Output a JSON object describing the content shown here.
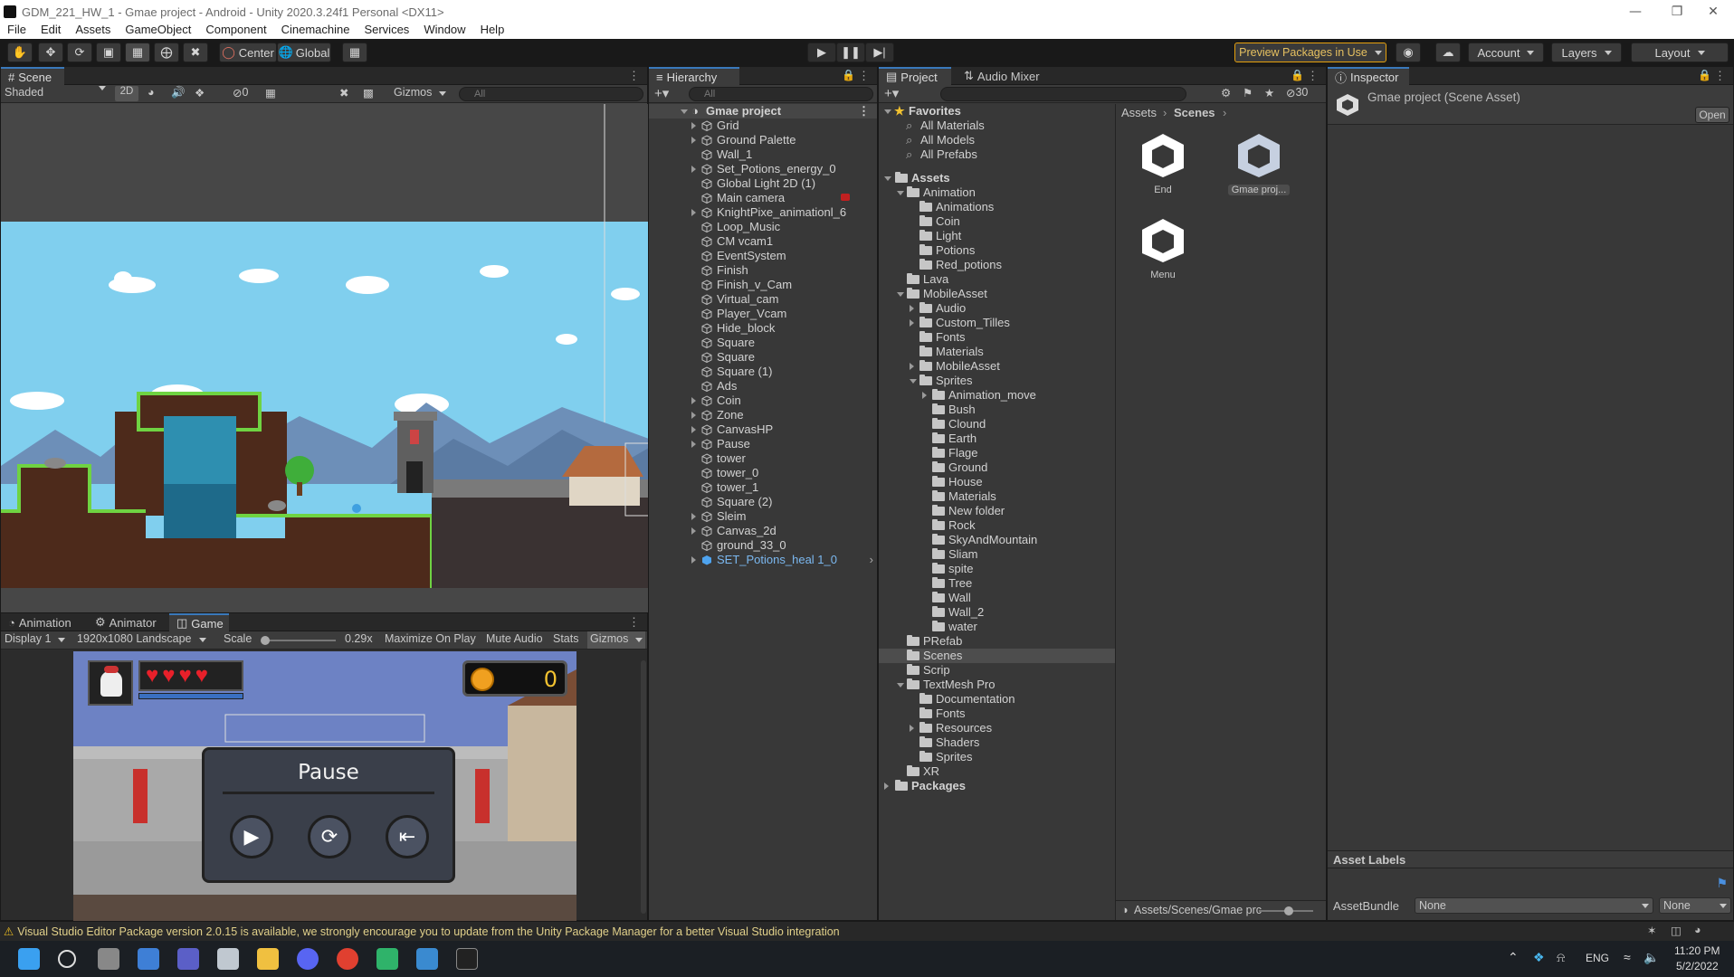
{
  "window": {
    "title": "GDM_221_HW_1 - Gmae project - Android - Unity 2020.3.24f1 Personal <DX11>"
  },
  "menu": [
    "File",
    "Edit",
    "Assets",
    "GameObject",
    "Component",
    "Cinemachine",
    "Services",
    "Window",
    "Help"
  ],
  "toolbar": {
    "pivot_label": "Center",
    "space_label": "Global",
    "preview_packages_label": "Preview Packages in Use",
    "account_label": "Account",
    "layers_label": "Layers",
    "layout_label": "Layout"
  },
  "scene": {
    "tab_label": "Scene",
    "shading_label": "Shaded",
    "mode_2d_label": "2D",
    "hidden_count": "0",
    "gizmos_label": "Gizmos",
    "search_placeholder": "All"
  },
  "bottom_tabs": {
    "animation": "Animation",
    "animator": "Animator",
    "game": "Game"
  },
  "game": {
    "display_label": "Display 1",
    "resolution_label": "1920x1080 Landscape",
    "scale_label": "Scale",
    "scale_value": "0.29x",
    "scale_level": 0.05,
    "maximize_label": "Maximize On Play",
    "mute_label": "Mute Audio",
    "stats_label": "Stats",
    "gizmos_label": "Gizmos",
    "coin_count": "0",
    "pause_title": "Pause",
    "hearts": 4
  },
  "hierarchy": {
    "tab_label": "Hierarchy",
    "search_placeholder": "All",
    "root": "Gmae project",
    "items": [
      {
        "label": "Grid",
        "arrow": true
      },
      {
        "label": "Ground Palette",
        "arrow": true
      },
      {
        "label": "Wall_1",
        "arrow": false
      },
      {
        "label": "Set_Potions_energy_0",
        "arrow": true
      },
      {
        "label": "Global Light 2D (1)",
        "arrow": false
      },
      {
        "label": "Main camera",
        "arrow": false
      },
      {
        "label": "KnightPixe_animationl_6",
        "arrow": true
      },
      {
        "label": "Loop_Music",
        "arrow": false
      },
      {
        "label": "CM vcam1",
        "arrow": false
      },
      {
        "label": "EventSystem",
        "arrow": false
      },
      {
        "label": "Finish",
        "arrow": false
      },
      {
        "label": "Finish_v_Cam",
        "arrow": false
      },
      {
        "label": "Virtual_cam",
        "arrow": false
      },
      {
        "label": "Player_Vcam",
        "arrow": false
      },
      {
        "label": "Hide_block",
        "arrow": false
      },
      {
        "label": "Square",
        "arrow": false
      },
      {
        "label": "Square",
        "arrow": false
      },
      {
        "label": "Square (1)",
        "arrow": false
      },
      {
        "label": "Ads",
        "arrow": false
      },
      {
        "label": "Coin",
        "arrow": true
      },
      {
        "label": "Zone",
        "arrow": true
      },
      {
        "label": "CanvasHP",
        "arrow": true
      },
      {
        "label": "Pause",
        "arrow": true
      },
      {
        "label": "tower",
        "arrow": false
      },
      {
        "label": "tower_0",
        "arrow": false
      },
      {
        "label": "tower_1",
        "arrow": false
      },
      {
        "label": "Square (2)",
        "arrow": false
      },
      {
        "label": "Sleim",
        "arrow": true
      },
      {
        "label": "Canvas_2d",
        "arrow": true
      },
      {
        "label": "ground_33_0",
        "arrow": false
      },
      {
        "label": "SET_Potions_heal 1_0",
        "arrow": true,
        "prefab": true
      }
    ]
  },
  "project": {
    "tab_label": "Project",
    "audio_mixer_label": "Audio Mixer",
    "hidden_count": "30",
    "favorites_label": "Favorites",
    "favorites": [
      "All Materials",
      "All Models",
      "All Prefabs"
    ],
    "assets_label": "Assets",
    "tree": [
      {
        "label": "Animation",
        "level": 1,
        "arrow": "open"
      },
      {
        "label": "Animations",
        "level": 2,
        "arrow": ""
      },
      {
        "label": "Coin",
        "level": 2,
        "arrow": ""
      },
      {
        "label": "Light",
        "level": 2,
        "arrow": ""
      },
      {
        "label": "Potions",
        "level": 2,
        "arrow": ""
      },
      {
        "label": "Red_potions",
        "level": 2,
        "arrow": ""
      },
      {
        "label": "Lava",
        "level": 1,
        "arrow": ""
      },
      {
        "label": "MobileAsset",
        "level": 1,
        "arrow": "open"
      },
      {
        "label": "Audio",
        "level": 2,
        "arrow": "closed"
      },
      {
        "label": "Custom_Tilles",
        "level": 2,
        "arrow": "closed"
      },
      {
        "label": "Fonts",
        "level": 2,
        "arrow": ""
      },
      {
        "label": "Materials",
        "level": 2,
        "arrow": ""
      },
      {
        "label": "MobileAsset",
        "level": 2,
        "arrow": "closed"
      },
      {
        "label": "Sprites",
        "level": 2,
        "arrow": "open"
      },
      {
        "label": "Animation_move",
        "level": 3,
        "arrow": "closed"
      },
      {
        "label": "Bush",
        "level": 3,
        "arrow": ""
      },
      {
        "label": "Clound",
        "level": 3,
        "arrow": ""
      },
      {
        "label": "Earth",
        "level": 3,
        "arrow": ""
      },
      {
        "label": "Flage",
        "level": 3,
        "arrow": ""
      },
      {
        "label": "Ground",
        "level": 3,
        "arrow": ""
      },
      {
        "label": "House",
        "level": 3,
        "arrow": ""
      },
      {
        "label": "Materials",
        "level": 3,
        "arrow": ""
      },
      {
        "label": "New folder",
        "level": 3,
        "arrow": ""
      },
      {
        "label": "Rock",
        "level": 3,
        "arrow": ""
      },
      {
        "label": "SkyAndMountain",
        "level": 3,
        "arrow": ""
      },
      {
        "label": "Sliam",
        "level": 3,
        "arrow": ""
      },
      {
        "label": "spite",
        "level": 3,
        "arrow": ""
      },
      {
        "label": "Tree",
        "level": 3,
        "arrow": ""
      },
      {
        "label": "Wall",
        "level": 3,
        "arrow": ""
      },
      {
        "label": "Wall_2",
        "level": 3,
        "arrow": ""
      },
      {
        "label": "water",
        "level": 3,
        "arrow": ""
      },
      {
        "label": "PRefab",
        "level": 1,
        "arrow": ""
      },
      {
        "label": "Scenes",
        "level": 1,
        "arrow": "",
        "selected": true
      },
      {
        "label": "Scrip",
        "level": 1,
        "arrow": ""
      },
      {
        "label": "TextMesh Pro",
        "level": 1,
        "arrow": "open"
      },
      {
        "label": "Documentation",
        "level": 2,
        "arrow": ""
      },
      {
        "label": "Fonts",
        "level": 2,
        "arrow": ""
      },
      {
        "label": "Resources",
        "level": 2,
        "arrow": "closed"
      },
      {
        "label": "Shaders",
        "level": 2,
        "arrow": ""
      },
      {
        "label": "Sprites",
        "level": 2,
        "arrow": ""
      },
      {
        "label": "XR",
        "level": 1,
        "arrow": ""
      }
    ],
    "packages_label": "Packages",
    "breadcrumb": [
      "Assets",
      "Scenes"
    ],
    "grid_items": [
      "End",
      "Gmae proj...",
      "Menu"
    ],
    "path": "Assets/Scenes/Gmae prc"
  },
  "inspector": {
    "tab_label": "Inspector",
    "title": "Gmae project (Scene Asset)",
    "open_label": "Open",
    "asset_labels": "Asset Labels",
    "assetbundle_label": "AssetBundle",
    "bundle_value": "None",
    "variant_value": "None"
  },
  "status": {
    "message": "Visual Studio Editor Package version 2.0.15 is available, we strongly encourage you to update from the Unity Package Manager for a better Visual Studio integration"
  },
  "taskbar": {
    "lang": "ENG",
    "time": "11:20 PM",
    "date": "5/2/2022"
  },
  "colors": {
    "accent": "#3a79bb",
    "warning": "#e1d08a",
    "preview_border": "#e5a00d",
    "prefab_blue": "#7bb8f0"
  }
}
